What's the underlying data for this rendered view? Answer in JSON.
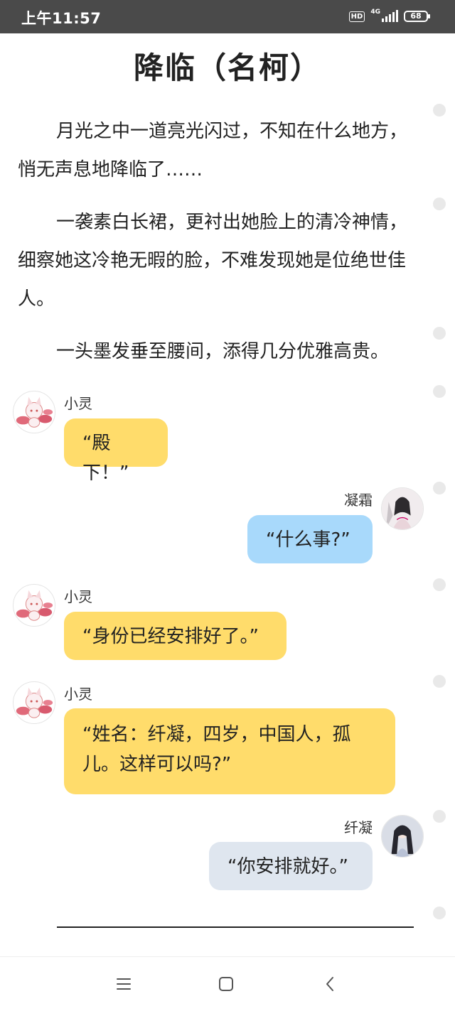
{
  "status_bar": {
    "time": "上午11:57",
    "hd": "HD",
    "network": "4G",
    "battery": "68"
  },
  "article": {
    "title": "降临（名柯）",
    "paragraphs": [
      "月光之中一道亮光闪过，不知在什么地方，悄无声息地降临了……",
      "一袭素白长裙，更衬出她脸上的清冷神情，细察她这冷艳无暇的脸，不难发现她是位绝世佳人。",
      "一头墨发垂至腰间，添得几分优雅高贵。"
    ]
  },
  "chat": [
    {
      "speaker": "小灵",
      "text": "“殿下！”",
      "side": "left",
      "color": "#ffdc6b",
      "avatar": "fox-avatar-icon"
    },
    {
      "speaker": "凝霜",
      "text": "“什么事?”",
      "side": "right",
      "color": "#a8d9fb",
      "avatar": "woman-avatar-icon"
    },
    {
      "speaker": "小灵",
      "text": "“身份已经安排好了。”",
      "side": "left",
      "color": "#ffdc6b",
      "avatar": "fox-avatar-icon"
    },
    {
      "speaker": "小灵",
      "text": "“姓名：纤凝，四岁，中国人，孤儿。这样可以吗?”",
      "side": "left",
      "color": "#ffdc6b",
      "avatar": "fox-avatar-icon"
    },
    {
      "speaker": "纤凝",
      "text": "“你安排就好。”",
      "side": "right",
      "color": "#dfe6ef",
      "avatar": "girl-avatar-icon"
    }
  ],
  "nav_bar": {
    "icons": [
      "menu-icon",
      "home-square-icon",
      "back-chevron-icon"
    ]
  }
}
